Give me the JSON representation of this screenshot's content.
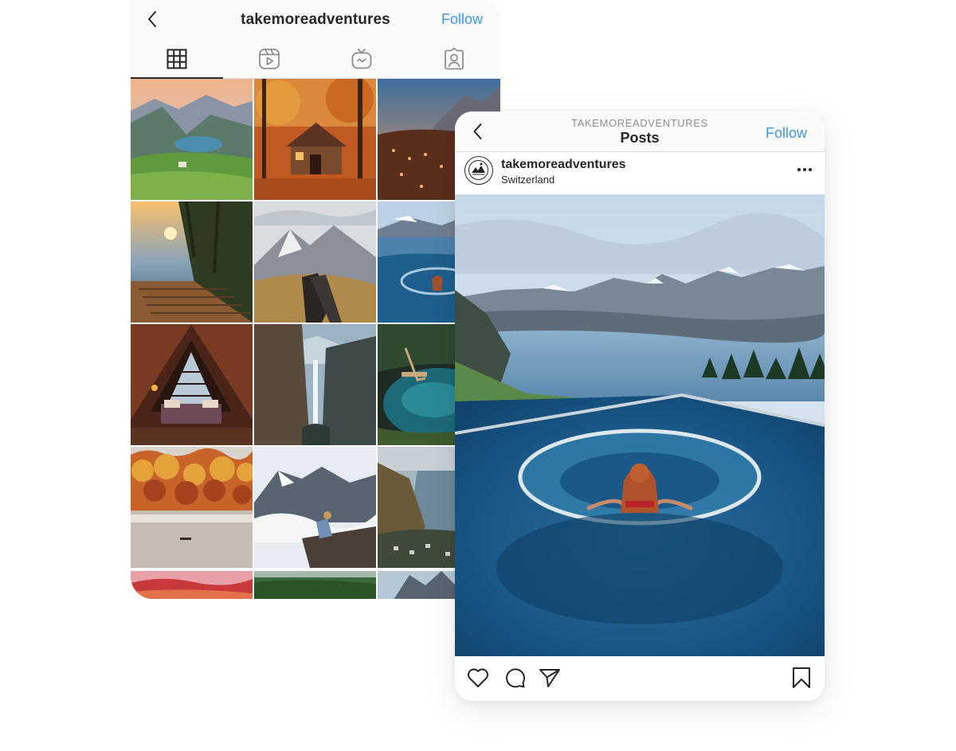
{
  "profile_view": {
    "username": "takemoreadventures",
    "follow_label": "Follow",
    "tabs": [
      {
        "name": "grid",
        "icon": "grid-icon",
        "active": true
      },
      {
        "name": "reels",
        "icon": "reels-icon",
        "active": false
      },
      {
        "name": "igtv",
        "icon": "igtv-icon",
        "active": false
      },
      {
        "name": "tagged",
        "icon": "tagged-icon",
        "active": false
      }
    ],
    "grid_thumbnail_count": 15
  },
  "post_view": {
    "account_caption": "TAKEMOREADVENTURES",
    "title": "Posts",
    "follow_label": "Follow",
    "username": "takemoreadventures",
    "location": "Switzerland",
    "actions": [
      "heart-icon",
      "comment-icon",
      "share-icon",
      "bookmark-icon"
    ]
  },
  "colors": {
    "follow": "#3897f0",
    "text": "#262626",
    "secondary": "#8e8e8e",
    "divider": "#dbdbdb",
    "header_bg": "#fafafa"
  }
}
